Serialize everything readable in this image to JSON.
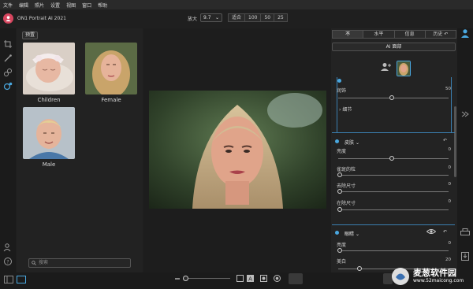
{
  "menu": [
    "文件",
    "编辑",
    "照片",
    "设置",
    "视图",
    "窗口",
    "帮助"
  ],
  "app": {
    "name": "ON1 Portrait AI 2021"
  },
  "zoom": {
    "label": "放大",
    "value": "9.7",
    "fit_options": [
      "适合",
      "100",
      "50",
      "25"
    ]
  },
  "browser": {
    "preset_button": "预置",
    "thumbnails": [
      {
        "caption": "Children"
      },
      {
        "caption": "Female"
      },
      {
        "caption": "Male"
      }
    ],
    "search_placeholder": "搜索"
  },
  "right": {
    "tabs": [
      "不",
      "水平",
      "信息",
      "历史"
    ],
    "ai_button": "AI 面部",
    "sections": {
      "top": {
        "slider_label": "润饰",
        "slider_value": "50",
        "sub_toggle": "细节"
      },
      "skin": {
        "title": "皮肤",
        "rows": [
          {
            "label": "亮度",
            "value": "0"
          },
          {
            "label": "雀斑的粒",
            "value": "0"
          },
          {
            "label": "去除尺寸",
            "value": "0"
          },
          {
            "label": "在除尺寸",
            "value": "0"
          }
        ]
      },
      "eyes": {
        "title": "眼睛",
        "rows": [
          {
            "label": "亮度",
            "value": "0"
          },
          {
            "label": "美白",
            "value": "20"
          }
        ]
      }
    }
  },
  "watermark": {
    "line1": "麦葱软件园",
    "line2": "www.52maicong.com"
  },
  "colors": {
    "accent": "#4aa8e0",
    "brand": "#d6455e"
  }
}
